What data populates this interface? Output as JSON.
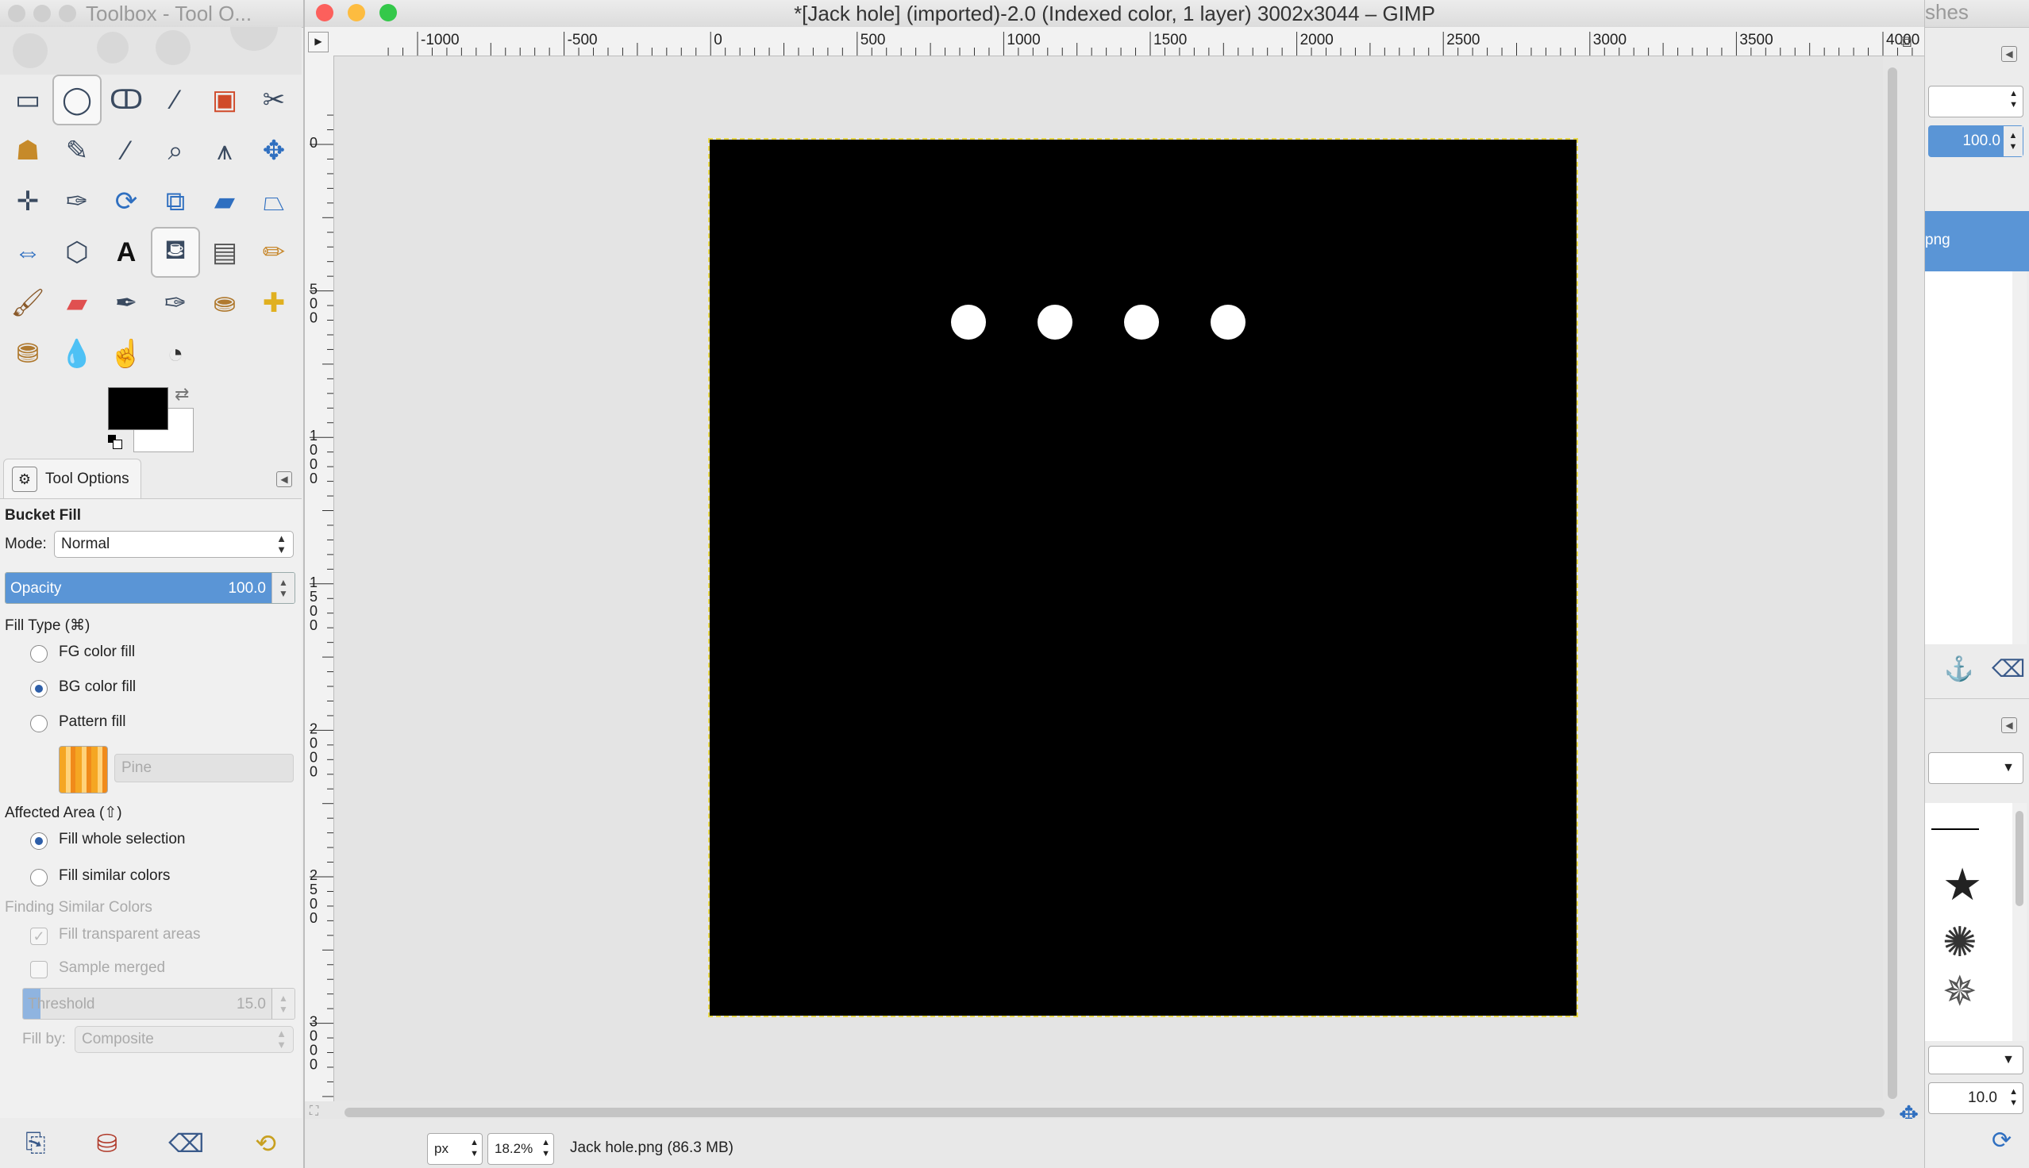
{
  "toolbox": {
    "title": "Toolbox - Tool O...",
    "tools": [
      "rect-select",
      "ellipse-select",
      "free-select",
      "fuzzy-select",
      "select-by-color",
      "scissors-select",
      "foreground-select",
      "paths",
      "color-picker",
      "zoom",
      "measure",
      "move",
      "align",
      "crop",
      "rotate",
      "scale",
      "shear",
      "perspective",
      "flip",
      "cage-transform",
      "text",
      "bucket-fill",
      "blend",
      "pencil",
      "paintbrush",
      "eraser",
      "airbrush",
      "ink",
      "clone",
      "heal",
      "perspective-clone",
      "blur-sharpen",
      "smudge",
      "dodge-burn"
    ],
    "active_tool_index": 21,
    "fg_color": "#000000",
    "bg_color": "#ffffff"
  },
  "tool_options": {
    "tab_label": "Tool Options",
    "tool_name": "Bucket Fill",
    "mode_label": "Mode:",
    "mode_value": "Normal",
    "opacity_label": "Opacity",
    "opacity_value": "100.0",
    "opacity_fraction": 1.0,
    "fill_type_label": "Fill Type  (⌘)",
    "fill_types": [
      "FG color fill",
      "BG color fill",
      "Pattern fill"
    ],
    "fill_type_selected": 1,
    "pattern_name": "Pine",
    "affected_area_label": "Affected Area  (⇧)",
    "affected_areas": [
      "Fill whole selection",
      "Fill similar colors"
    ],
    "affected_area_selected": 0,
    "finding_similar_label": "Finding Similar Colors",
    "fill_transparent_label": "Fill transparent areas",
    "sample_merged_label": "Sample merged",
    "threshold_label": "Threshold",
    "threshold_value": "15.0",
    "fill_by_label": "Fill by:",
    "fill_by_value": "Composite"
  },
  "image_window": {
    "title": "*[Jack hole] (imported)-2.0 (Indexed color, 1 layer) 3002x3044 – GIMP",
    "hruler_labels": [
      "-1000",
      "-500",
      "0",
      "500",
      "1000",
      "1500",
      "2000",
      "2500",
      "3000",
      "3500",
      "4000"
    ],
    "vruler_labels": [
      "0",
      "500",
      "1000",
      "1500",
      "2000",
      "2500",
      "3000"
    ],
    "unit": "px",
    "zoom": "18.2%",
    "status": "Jack hole.png (86.3 MB)"
  },
  "dock": {
    "title_fragment": "shes",
    "opacity_value": "100.0",
    "layer_name_fragment": "png",
    "brush_size": "10.0"
  },
  "colors": {
    "accent": "#5a95d6",
    "close": "#fc605c",
    "minimize": "#fdbc40",
    "maximize": "#34c84a",
    "selection_marching": "#e8d84a"
  }
}
